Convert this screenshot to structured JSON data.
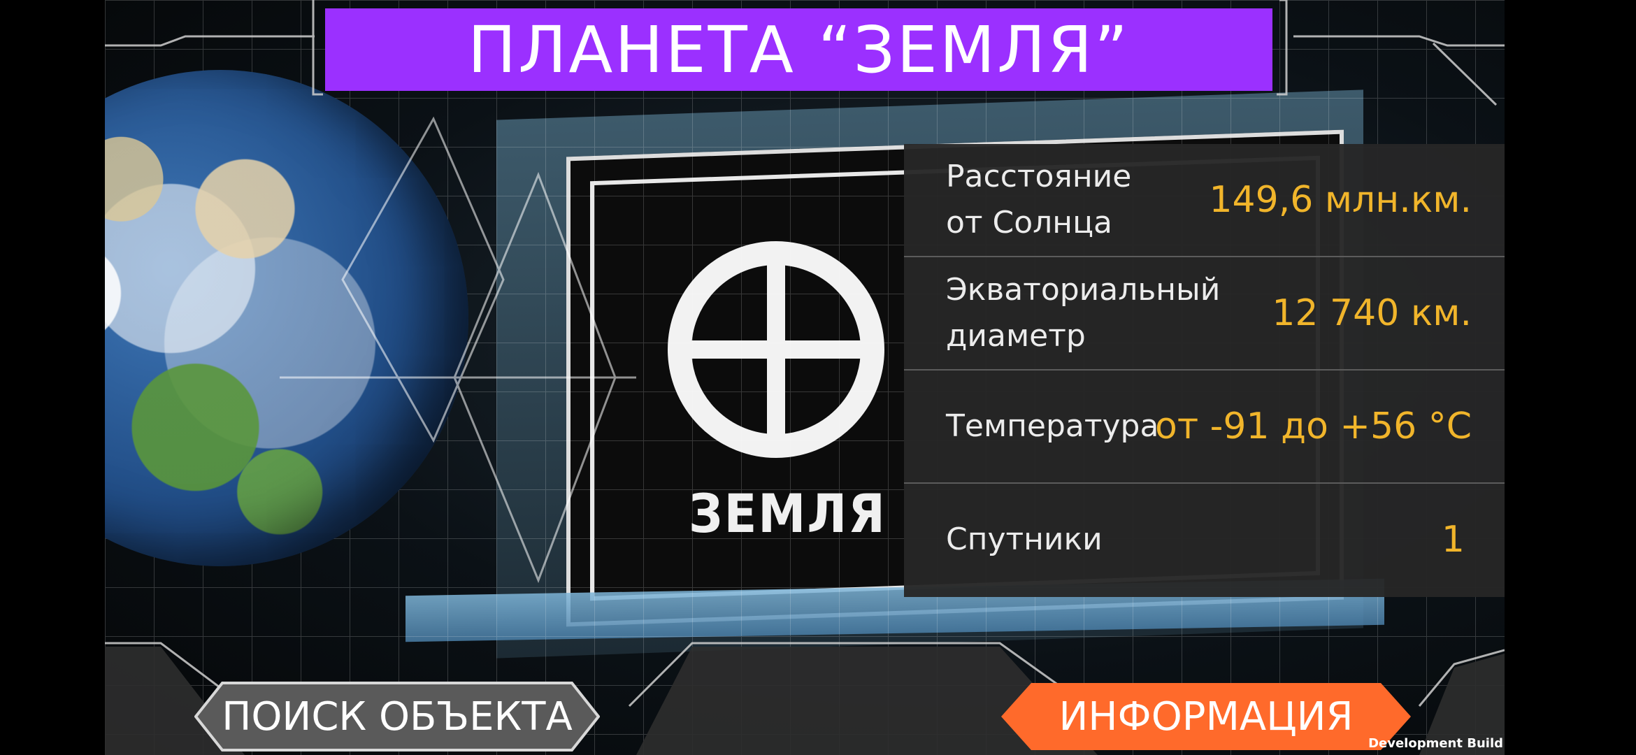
{
  "title": "ПЛАНЕТА “ЗЕМЛЯ”",
  "marker_label": "ЗЕМЛЯ",
  "info": [
    {
      "label": "Расстояние\nот Солнца",
      "value": "149,6 млн.км."
    },
    {
      "label": "Экваториальный\nдиаметр",
      "value": "12 740 км."
    },
    {
      "label": "Температура",
      "value": "от -91 до +56 °C"
    },
    {
      "label": "Спутники",
      "value": "1"
    }
  ],
  "buttons": {
    "search": "ПОИСК ОБЪЕКТА",
    "info": "ИНФОРМАЦИЯ"
  },
  "footer": {
    "build": "Development Build"
  },
  "colors": {
    "title_bg": "#9b30ff",
    "value_text": "#f1b52b",
    "search_button": "#5a5a5a",
    "info_button": "#ff6a2b"
  },
  "icons": {
    "earth": "earth-globe-icon",
    "marker": "earth-symbol-icon"
  }
}
